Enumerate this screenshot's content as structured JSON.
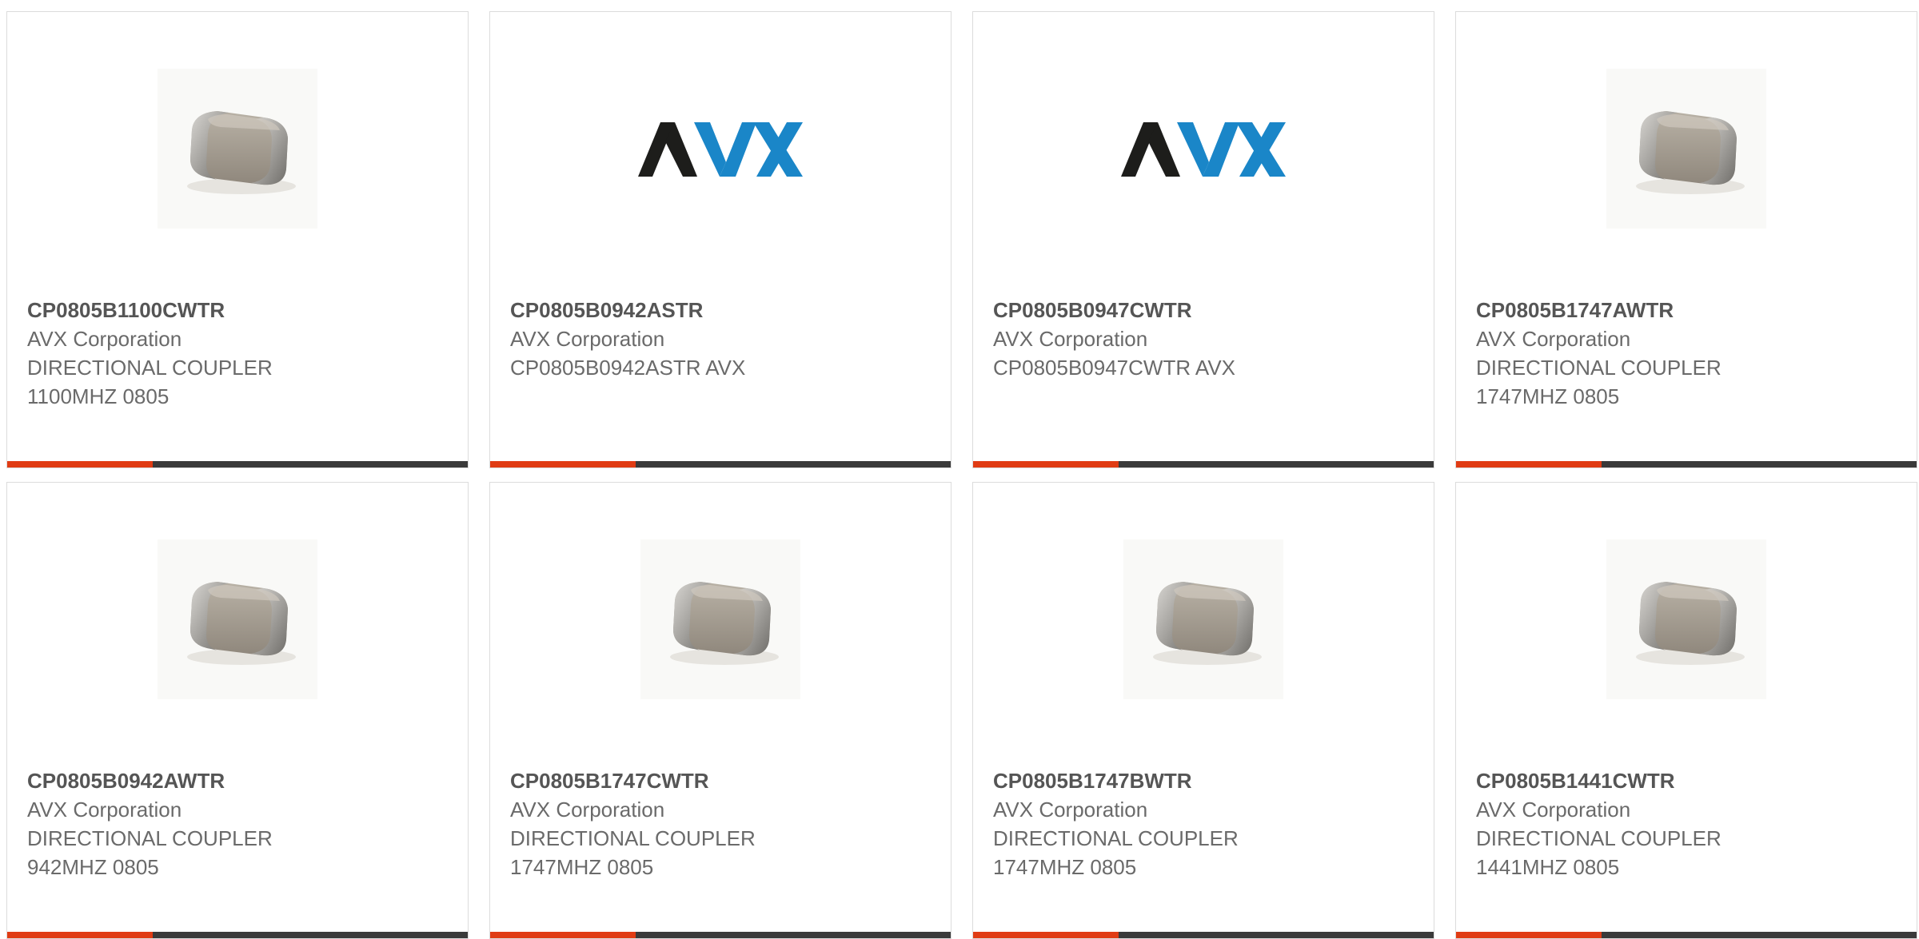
{
  "colors": {
    "card_border": "#dcdcdc",
    "part_number_text": "#555555",
    "body_text": "#6a6a6a",
    "bar_dark": "#3a3a3a",
    "bar_accent": "#e03c14",
    "logo_black": "#1d1d1b",
    "logo_blue": "#1a86c8"
  },
  "products": [
    {
      "image": "chip-icon",
      "part_number": "CP0805B1100CWTR",
      "manufacturer": "AVX Corporation",
      "desc1": "DIRECTIONAL COUPLER",
      "desc2": "1100MHZ 0805"
    },
    {
      "image": "avx-logo",
      "logo_text": "AVX",
      "part_number": "CP0805B0942ASTR",
      "manufacturer": "AVX Corporation",
      "desc1": "CP0805B0942ASTR AVX",
      "desc2": ""
    },
    {
      "image": "avx-logo",
      "logo_text": "AVX",
      "part_number": "CP0805B0947CWTR",
      "manufacturer": "AVX Corporation",
      "desc1": "CP0805B0947CWTR AVX",
      "desc2": ""
    },
    {
      "image": "chip-icon",
      "part_number": "CP0805B1747AWTR",
      "manufacturer": "AVX Corporation",
      "desc1": "DIRECTIONAL COUPLER",
      "desc2": "1747MHZ 0805"
    },
    {
      "image": "chip-icon",
      "part_number": "CP0805B0942AWTR",
      "manufacturer": "AVX Corporation",
      "desc1": "DIRECTIONAL COUPLER",
      "desc2": "942MHZ 0805"
    },
    {
      "image": "chip-icon",
      "part_number": "CP0805B1747CWTR",
      "manufacturer": "AVX Corporation",
      "desc1": "DIRECTIONAL COUPLER",
      "desc2": "1747MHZ 0805"
    },
    {
      "image": "chip-icon",
      "part_number": "CP0805B1747BWTR",
      "manufacturer": "AVX Corporation",
      "desc1": "DIRECTIONAL COUPLER",
      "desc2": "1747MHZ 0805"
    },
    {
      "image": "chip-icon",
      "part_number": "CP0805B1441CWTR",
      "manufacturer": "AVX Corporation",
      "desc1": "DIRECTIONAL COUPLER",
      "desc2": "1441MHZ 0805"
    }
  ]
}
